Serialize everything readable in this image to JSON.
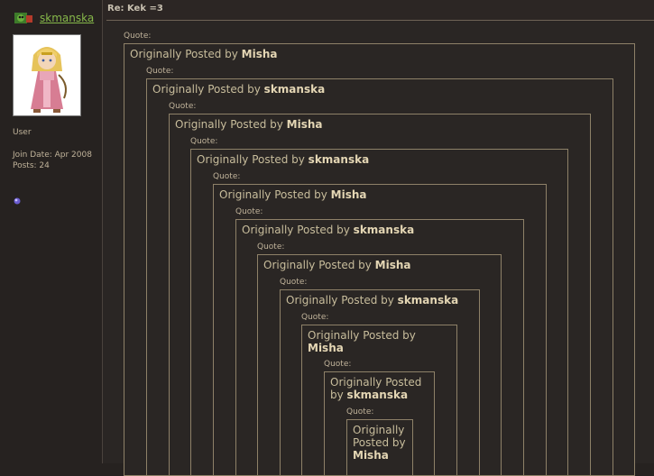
{
  "sidebar": {
    "username": "skmanska",
    "rank": "User",
    "join_date": "Join Date: Apr 2008",
    "posts": "Posts: 24"
  },
  "post": {
    "title": "Re: Kek =3"
  },
  "quotes": [
    {
      "label": "Quote:",
      "prefix": "Originally Posted by",
      "author": "Misha"
    },
    {
      "label": "Quote:",
      "prefix": "Originally Posted by",
      "author": "skmanska"
    },
    {
      "label": "Quote:",
      "prefix": "Originally Posted by",
      "author": "Misha"
    },
    {
      "label": "Quote:",
      "prefix": "Originally Posted by",
      "author": "skmanska"
    },
    {
      "label": "Quote:",
      "prefix": "Originally Posted by",
      "author": "Misha"
    },
    {
      "label": "Quote:",
      "prefix": "Originally Posted by",
      "author": "skmanska"
    },
    {
      "label": "Quote:",
      "prefix": "Originally Posted by",
      "author": "Misha"
    },
    {
      "label": "Quote:",
      "prefix": "Originally Posted by",
      "author": "skmanska"
    },
    {
      "label": "Quote:",
      "prefix": "Originally Posted by",
      "author": "Misha"
    },
    {
      "label": "Quote:",
      "prefix": "Originally Posted by",
      "author": "skmanska"
    },
    {
      "label": "Quote:",
      "prefix": "Originally Posted by",
      "author": "Misha"
    }
  ]
}
